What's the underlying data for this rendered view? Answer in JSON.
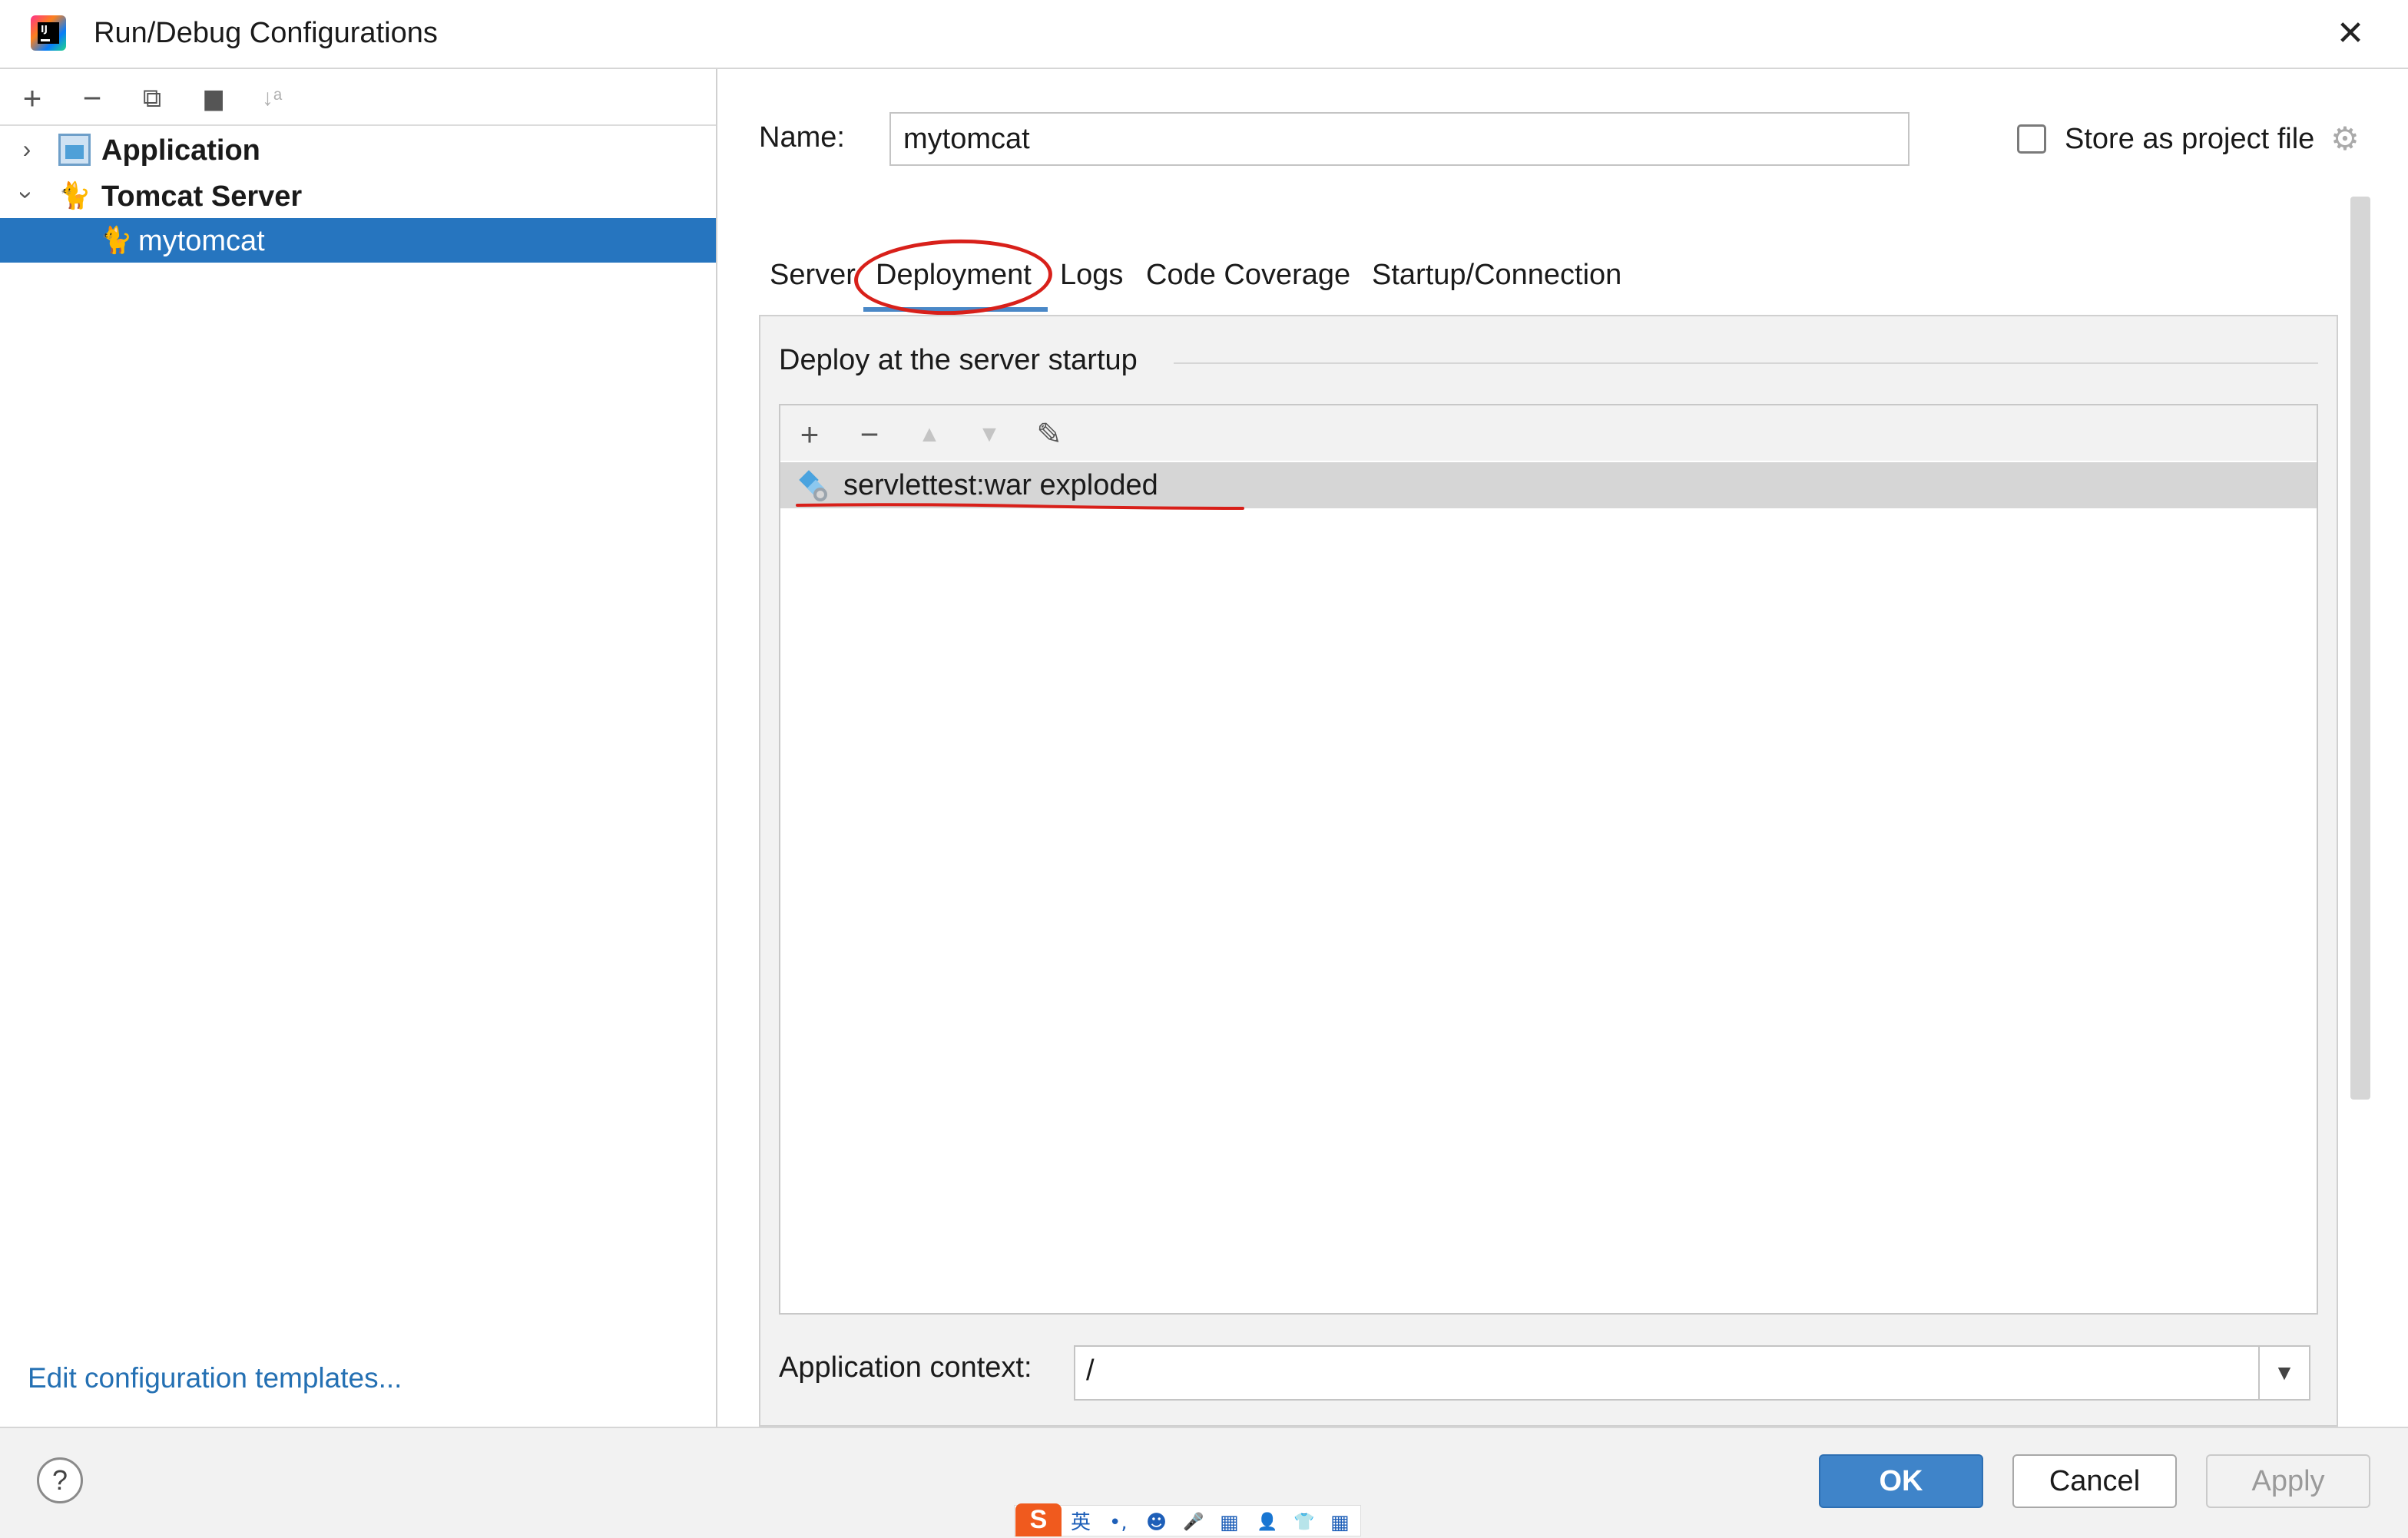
{
  "window": {
    "title": "Run/Debug Configurations",
    "close_glyph": "✕"
  },
  "left_toolbar": {
    "add": "+",
    "remove": "−",
    "copy": "⧉",
    "folder": "▆",
    "sort": "↓ᵃ"
  },
  "tree": [
    {
      "label": "Application",
      "icon": "application-icon",
      "expanded": false
    },
    {
      "label": "Tomcat Server",
      "icon": "tomcat-icon",
      "expanded": true
    },
    {
      "label": "mytomcat",
      "icon": "tomcat-icon",
      "selected": true
    }
  ],
  "edit_templates_link": "Edit configuration templates...",
  "name_field": {
    "label": "Name:",
    "value": "mytomcat"
  },
  "store_project_file": {
    "label": "Store as project file",
    "checked": false
  },
  "tabs": [
    "Server",
    "Deployment",
    "Logs",
    "Code Coverage",
    "Startup/Connection"
  ],
  "active_tab": "Deployment",
  "deployment": {
    "heading": "Deploy at the server startup",
    "toolbar": {
      "add": "+",
      "remove": "−",
      "up": "▲",
      "down": "▼",
      "edit": "✎"
    },
    "artifacts": [
      "servlettest:war exploded"
    ]
  },
  "app_context": {
    "label": "Application context:",
    "value": "/",
    "dropdown": "▼"
  },
  "buttons": {
    "help": "?",
    "ok": "OK",
    "cancel": "Cancel",
    "apply": "Apply"
  },
  "ime": {
    "logo": "S",
    "items": [
      "英",
      "•,",
      "☻",
      "🎤",
      "▦",
      "👤",
      "👕",
      "▦"
    ]
  },
  "colors": {
    "selection": "#2675bf",
    "ok": "#3f84c9",
    "link": "#2470b3",
    "annotation": "#d8201a"
  }
}
